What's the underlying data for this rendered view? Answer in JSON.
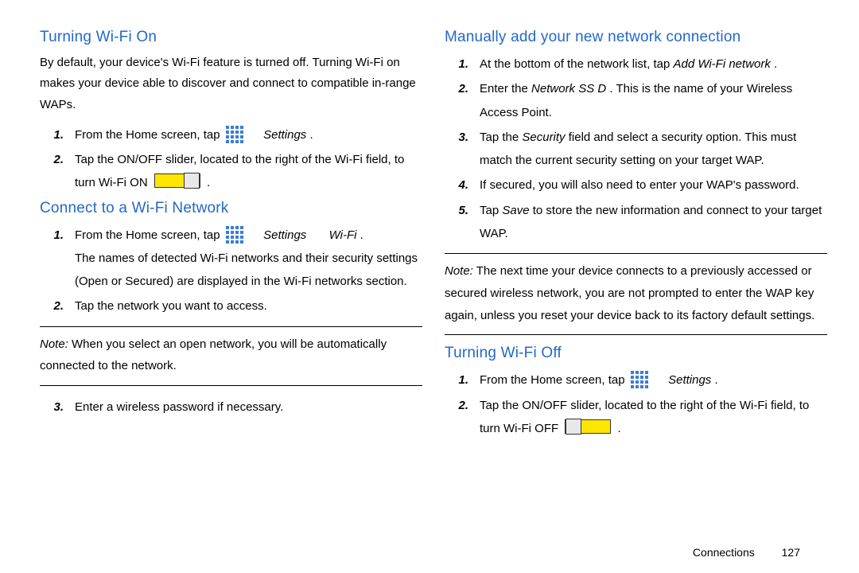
{
  "left": {
    "h_on": "Turning Wi-Fi On",
    "on_intro": "By default, your device's Wi-Fi feature is turned off. Turning Wi-Fi on makes your device able to discover and connect to compatible in-range WAPs.",
    "on_s1_a": "From the Home screen, tap ",
    "on_s1_b": "Settings",
    "on_s1_c": " .",
    "on_s2_a": "Tap the ON/OFF slider, located to the right of the Wi-Fi field, to turn Wi-Fi ON ",
    "on_s2_b": " .",
    "h_connect": "Connect to a Wi-Fi Network",
    "c_s1_a": "From the Home screen, tap ",
    "c_s1_b": "Settings",
    "c_s1_c": "Wi-Fi",
    "c_s1_d": ".",
    "c_s1_rest": "The names of detected Wi-Fi networks and their security settings (Open or Secured) are displayed in the Wi-Fi networks section.",
    "c_s2": "Tap the network you want to access.",
    "c_note_lead": "Note:",
    "c_note_body": " When you select an open network, you will be automatically connected to the network.",
    "c_s3": "Enter a wireless password if necessary."
  },
  "right": {
    "h_manual": "Manually add your new network connection",
    "m_s1_a": "At the bottom of the network list, tap ",
    "m_s1_b": "Add Wi-Fi network",
    "m_s1_c": " .",
    "m_s2_a": "Enter the ",
    "m_s2_b": "Network SS D",
    "m_s2_c": " . This is the name of your Wireless Access Point.",
    "m_s3_a": "Tap the ",
    "m_s3_b": "Security",
    "m_s3_c": " field and select a security option. This must match the current security setting on your target WAP.",
    "m_s4": "If secured, you will also need to enter your WAP's password.",
    "m_s5_a": "Tap ",
    "m_s5_b": "Save",
    "m_s5_c": " to store the new information and connect to your target WAP.",
    "m_note_lead": "Note:",
    "m_note_body": " The next time your device connects to a previously accessed or secured wireless network, you are not prompted to enter the WAP key again, unless you reset your device back to its factory default settings.",
    "h_off": "Turning Wi-Fi Off",
    "off_s1_a": "From the Home screen, tap ",
    "off_s1_b": "Settings",
    "off_s1_c": " .",
    "off_s2_a": "Tap the ON/OFF slider, located to the right of the Wi-Fi field, to turn Wi-Fi OFF ",
    "off_s2_b": " ."
  },
  "nums": {
    "n1": "1.",
    "n2": "2.",
    "n3": "3.",
    "n4": "4.",
    "n5": "5."
  },
  "footer": {
    "chapter": "Connections",
    "page": "127"
  }
}
